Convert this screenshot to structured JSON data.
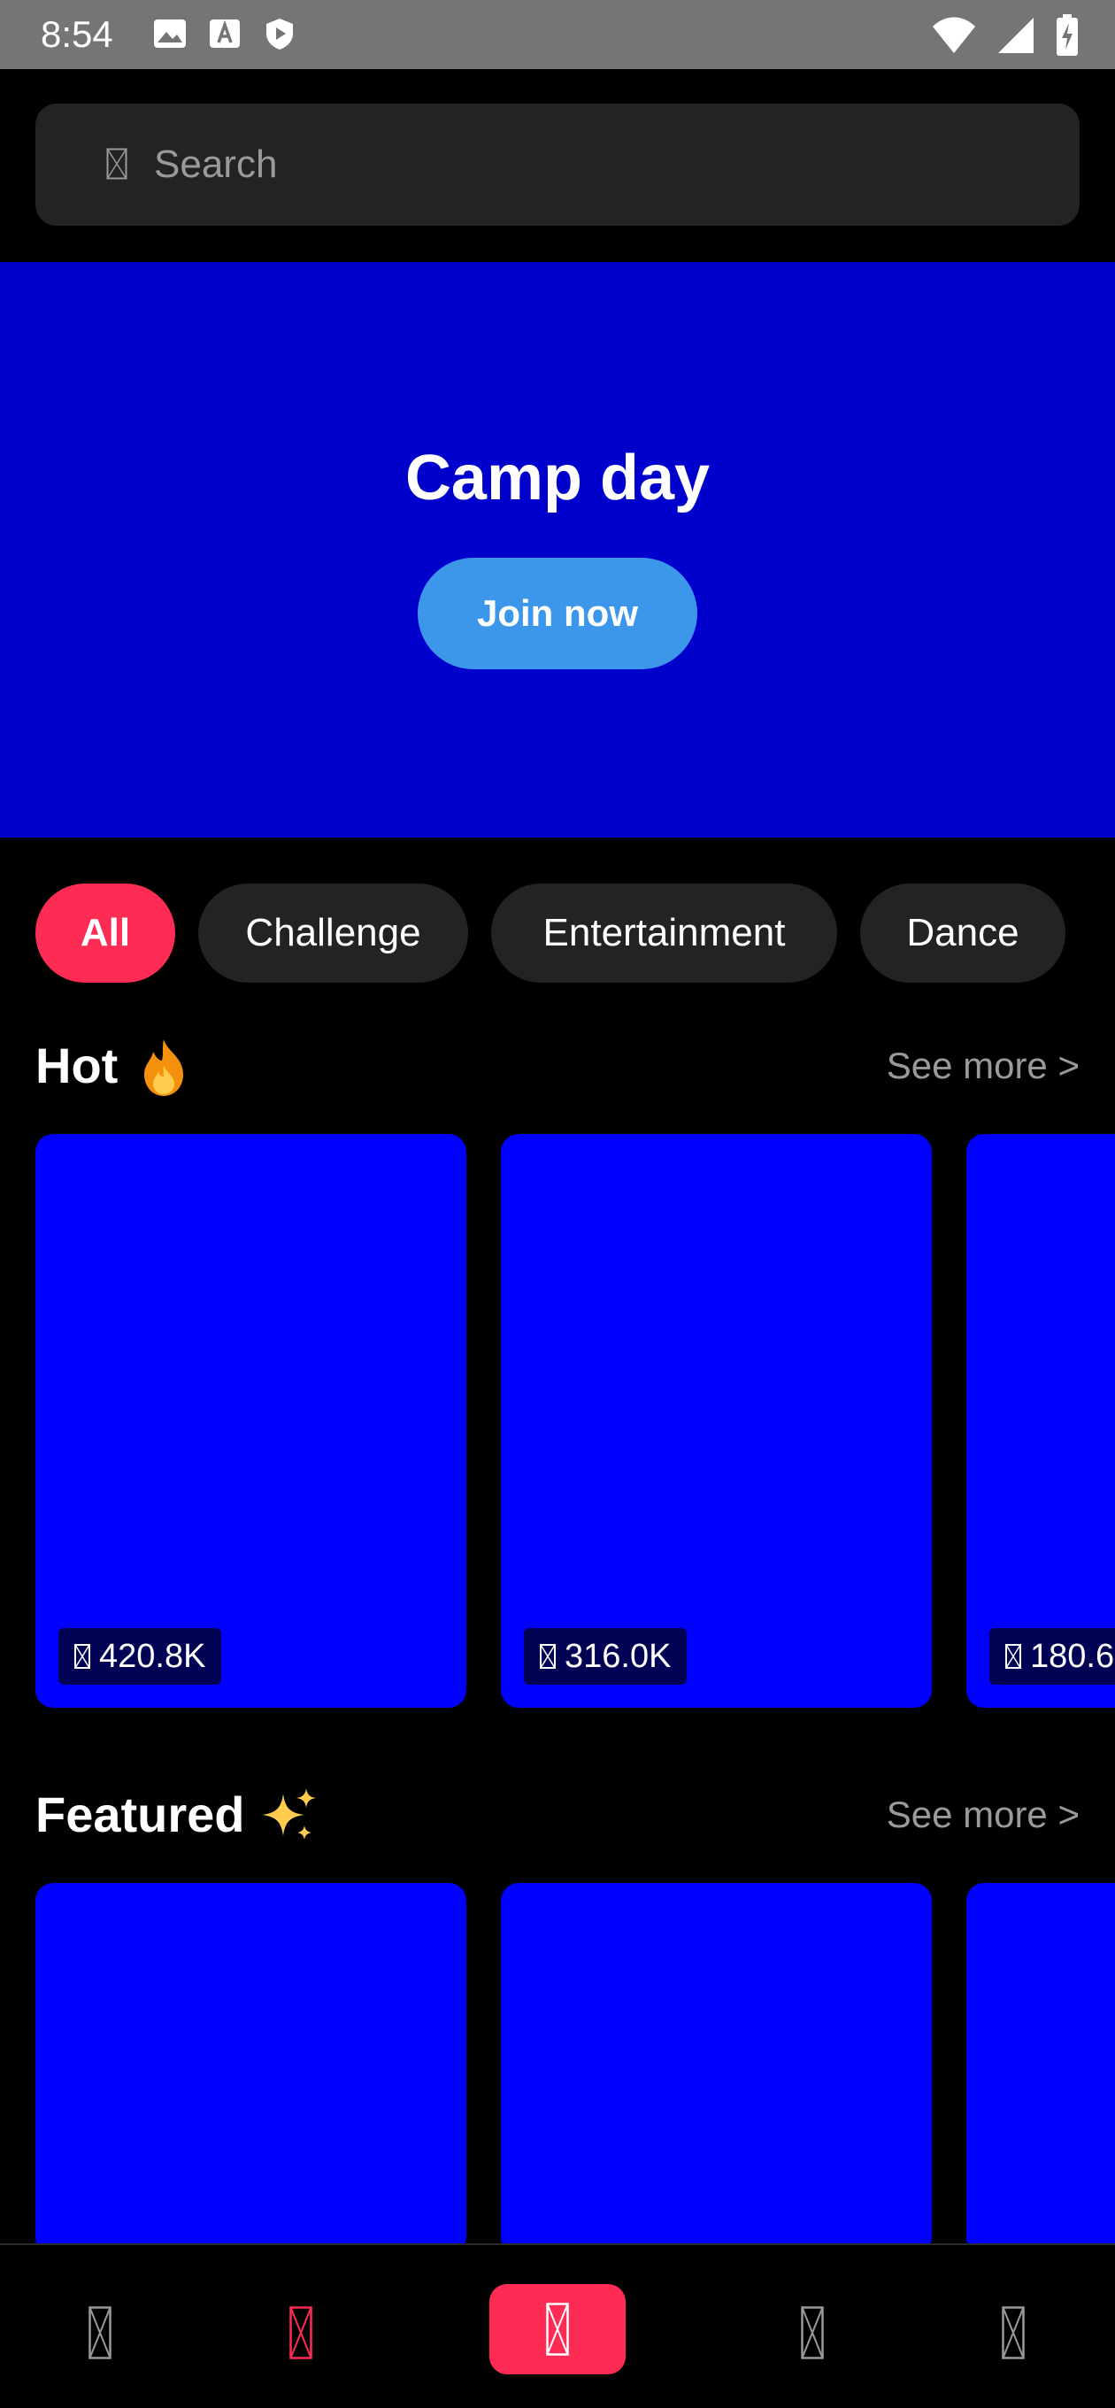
{
  "status_bar": {
    "time": "8:54",
    "left_icons": [
      "image-icon",
      "font-icon",
      "shield-icon"
    ],
    "right_icons": [
      "wifi-icon",
      "signal-icon",
      "battery-charging-icon"
    ]
  },
  "search": {
    "placeholder": "Search",
    "icon": "search-icon"
  },
  "banner": {
    "title": "Camp day",
    "button_label": "Join now",
    "background": "#0000cc",
    "button_color": "#3c96ea"
  },
  "categories": [
    {
      "label": "All",
      "active": true
    },
    {
      "label": "Challenge",
      "active": false
    },
    {
      "label": "Entertainment",
      "active": false
    },
    {
      "label": "Dance",
      "active": false
    }
  ],
  "sections": {
    "hot": {
      "title": "Hot",
      "emoji": "fire",
      "see_more": "See more >",
      "cards": [
        {
          "views": "420.8K"
        },
        {
          "views": "316.0K"
        },
        {
          "views": "180.6"
        }
      ]
    },
    "featured": {
      "title": "Featured",
      "emoji": "sparkles",
      "see_more": "See more >",
      "cards": [
        {},
        {},
        {}
      ]
    }
  },
  "bottom_nav": {
    "items": [
      "home-icon",
      "discover-icon",
      "create-icon",
      "inbox-icon",
      "profile-icon"
    ],
    "active_index": 1
  },
  "colors": {
    "accent": "#fe2c55",
    "card": "#0000ff",
    "chip": "#232323",
    "background": "#000000"
  }
}
